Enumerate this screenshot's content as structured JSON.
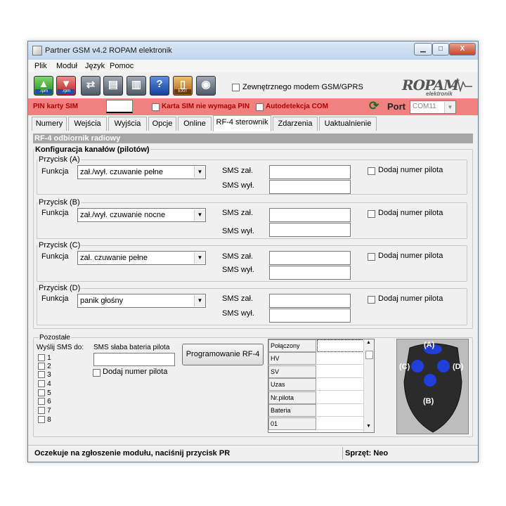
{
  "window": {
    "title": "Partner GSM v4.2 ROPAM elektronik",
    "controls": {
      "minimize": "▁",
      "maximize": "□",
      "close": "X"
    }
  },
  "menu": {
    "items": [
      "Plik",
      "Moduł",
      "Język",
      "Pomoc"
    ]
  },
  "toolbar": {
    "buttons": [
      {
        "icon": "upload-icon",
        "sub": ".rpm"
      },
      {
        "icon": "download-icon",
        "sub": ".rpm"
      },
      {
        "icon": "connect-icon",
        "sub": ""
      },
      {
        "icon": "read-icon",
        "sub": ""
      },
      {
        "icon": "write-icon",
        "sub": ""
      },
      {
        "icon": "help-icon",
        "sub": ""
      },
      {
        "icon": "exit-icon",
        "sub": "EXIT"
      },
      {
        "icon": "wireless-icon",
        "sub": ""
      }
    ],
    "external_modem_label": "Zewnętrznego modem GSM/GPRS",
    "logo_text": "ROPAM",
    "logo_sub": "elektronik"
  },
  "pinbar": {
    "pin_label": "PIN karty SIM",
    "pin_value": "",
    "sim_no_pin_label": "Karta SIM nie wymaga PIN",
    "autodetect_label": "Autodetekcja COM",
    "port_label": "Port",
    "port_value": "COM11"
  },
  "tabs": [
    "Numery",
    "Wejścia",
    "Wyjścia",
    "Opcje",
    "Online",
    "RF-4 sterownik",
    "Zdarzenia",
    "Uaktualnienie"
  ],
  "rf": {
    "section_title": "RF-4 odbiornik radiowy",
    "config_title": "Konfiguracja kanałów (pilotów)",
    "function_label": "Funkcja",
    "sms_on_label": "SMS zał.",
    "sms_off_label": "SMS wył.",
    "add_remote_label": "Dodaj numer pilota",
    "buttons": [
      {
        "label": "Przycisk (A)",
        "function": "zał./wył. czuwanie pełne",
        "sms_on": "",
        "sms_off": ""
      },
      {
        "label": "Przycisk (B)",
        "function": "zał./wył. czuwanie nocne",
        "sms_on": "",
        "sms_off": ""
      },
      {
        "label": "Przycisk (C)",
        "function": "zał. czuwanie pełne",
        "sms_on": "",
        "sms_off": ""
      },
      {
        "label": "Przycisk (D)",
        "function": "panik głośny",
        "sms_on": "",
        "sms_off": ""
      }
    ]
  },
  "other": {
    "title": "Pozostałe",
    "send_sms_label": "Wyślij SMS do:",
    "numbers": [
      "1",
      "2",
      "3",
      "4",
      "5",
      "6",
      "7",
      "8"
    ],
    "low_battery_label": "SMS słaba bateria pilota",
    "low_battery_value": "",
    "add_remote_label": "Dodaj numer pilota",
    "program_button": "Programowanie  RF-4",
    "grid_rows": [
      "Połączony",
      "HV",
      "SV",
      "Uzas",
      "Nr.pilota",
      "Bateria",
      "01"
    ]
  },
  "remote": {
    "a": "(A)",
    "b": "(B)",
    "c": "(C)",
    "d": "(D)"
  },
  "status": {
    "message": "Oczekuje na zgłoszenie modułu, naciśnij przycisk PR",
    "hardware": "Sprzęt: Neo"
  }
}
